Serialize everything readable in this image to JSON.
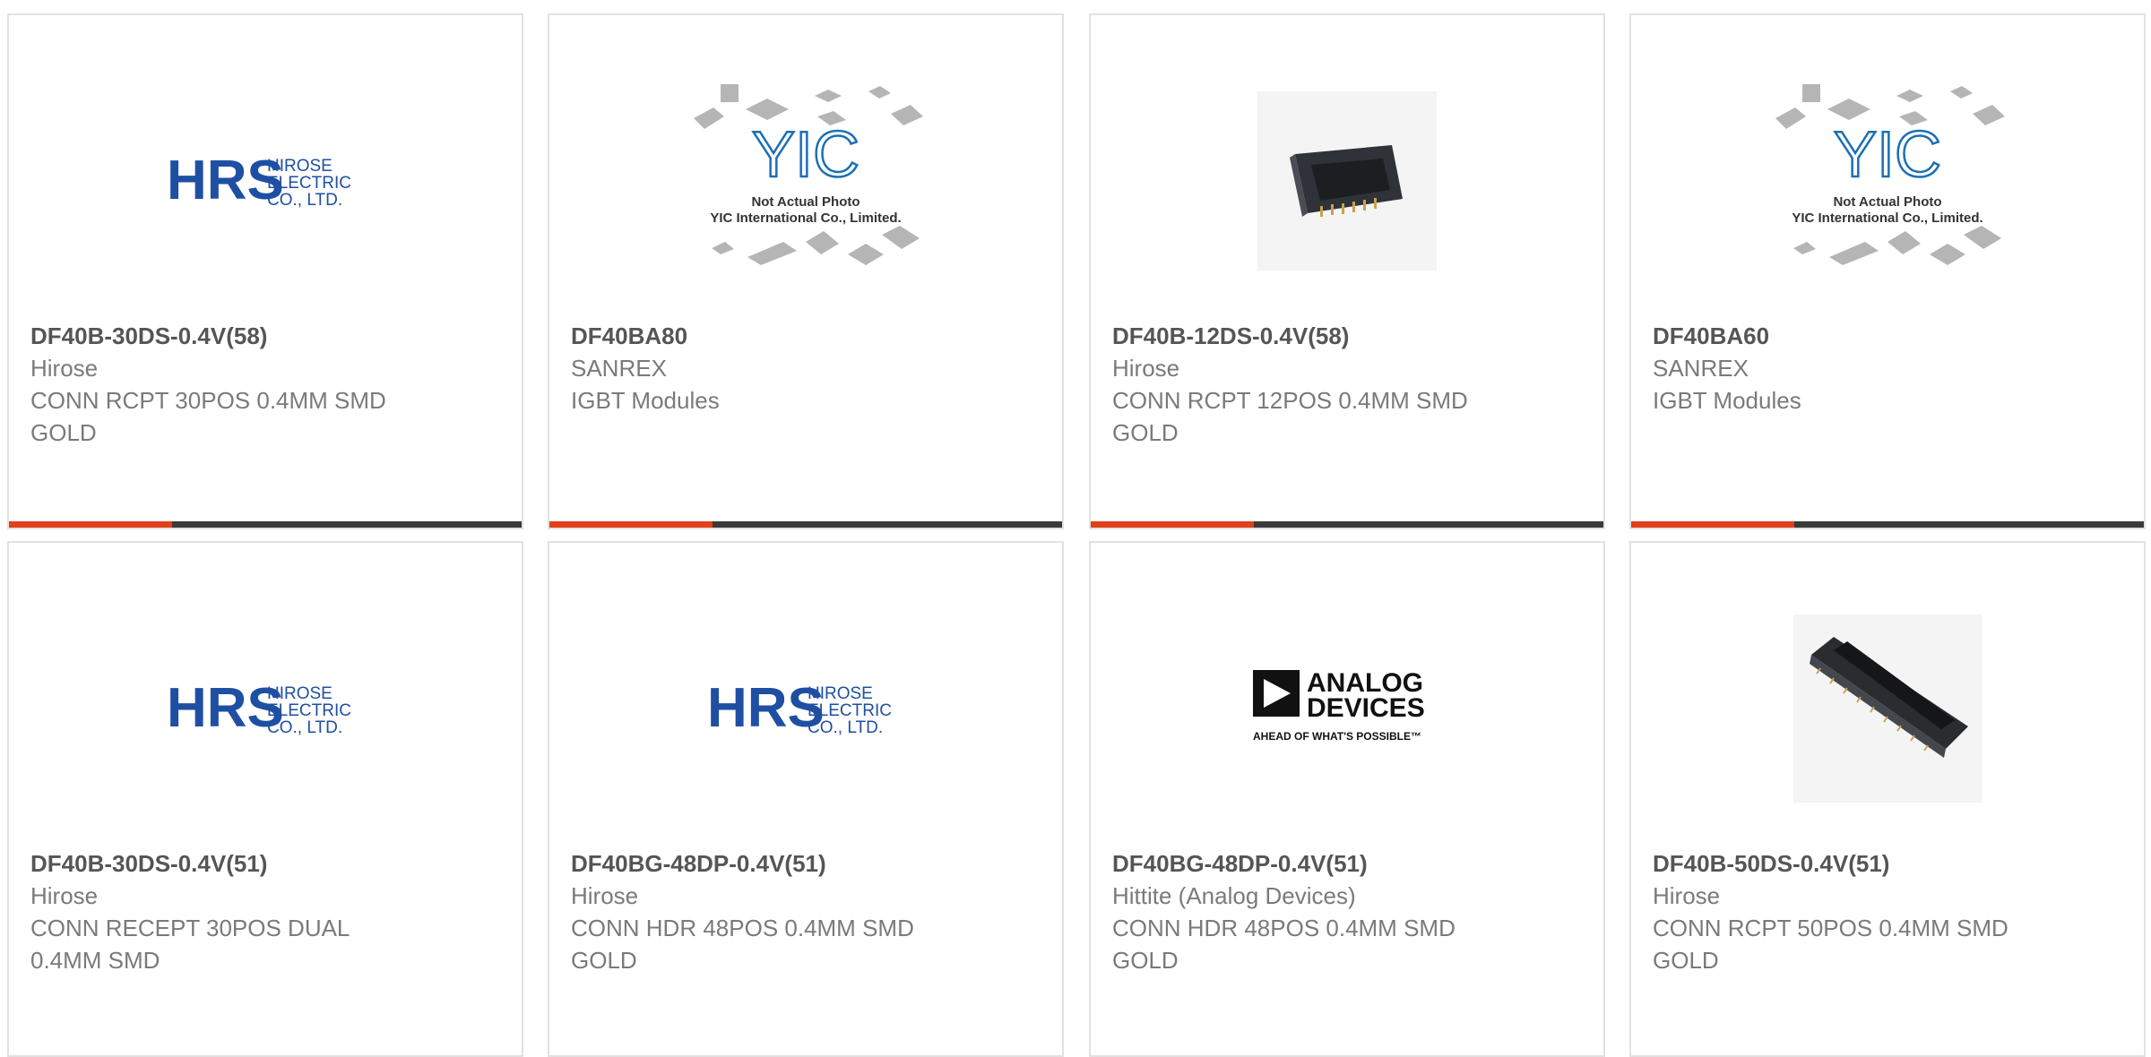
{
  "products": [
    {
      "part": "DF40B-30DS-0.4V(58)",
      "manufacturer": "Hirose",
      "description": "CONN RCPT 30POS 0.4MM SMD GOLD",
      "image": "hirose-logo"
    },
    {
      "part": "DF40BA80",
      "manufacturer": "SANREX",
      "description": "IGBT Modules",
      "image": "yic-placeholder"
    },
    {
      "part": "DF40B-12DS-0.4V(58)",
      "manufacturer": "Hirose",
      "description": "CONN RCPT 12POS 0.4MM SMD GOLD",
      "image": "connector-photo"
    },
    {
      "part": "DF40BA60",
      "manufacturer": "SANREX",
      "description": "IGBT Modules",
      "image": "yic-placeholder"
    },
    {
      "part": "DF40B-30DS-0.4V(51)",
      "manufacturer": "Hirose",
      "description": "CONN RECEPT 30POS DUAL 0.4MM SMD",
      "image": "hirose-logo"
    },
    {
      "part": "DF40BG-48DP-0.4V(51)",
      "manufacturer": "Hirose",
      "description": "CONN HDR 48POS 0.4MM SMD GOLD",
      "image": "hirose-logo"
    },
    {
      "part": "DF40BG-48DP-0.4V(51)",
      "manufacturer": "Hittite (Analog Devices)",
      "description": "CONN HDR 48POS 0.4MM SMD GOLD",
      "image": "analog-devices-logo"
    },
    {
      "part": "DF40B-50DS-0.4V(51)",
      "manufacturer": "Hirose",
      "description": "CONN RCPT 50POS 0.4MM SMD GOLD",
      "image": "connector-photo"
    }
  ],
  "logos": {
    "hirose": {
      "mark": "HRS",
      "line1": "HIROSE",
      "line2": "ELECTRIC",
      "line3": "CO., LTD."
    },
    "yic": {
      "mark": "YIC",
      "line1": "Not Actual Photo",
      "line2": "YIC International Co., Limited."
    },
    "analog": {
      "line1": "ANALOG",
      "line2": "DEVICES",
      "tagline": "AHEAD OF WHAT'S POSSIBLE™"
    }
  },
  "colors": {
    "accent": "#e0401a",
    "bar": "#3a3a3a",
    "hirose_blue": "#1f4fa3",
    "yic_blue": "#1a6fb5"
  }
}
